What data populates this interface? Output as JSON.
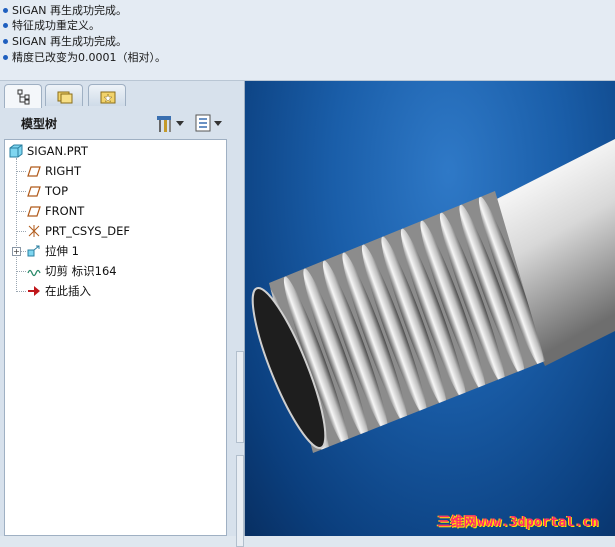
{
  "messages": [
    "SIGAN 再生成功完成。",
    "特征成功重定义。",
    "SIGAN 再生成功完成。",
    "精度已改变为0.0001（相对）。"
  ],
  "panel": {
    "tabs": [
      {
        "icon": "model-tree-tab-icon",
        "active": true
      },
      {
        "icon": "folder-browser-tab-icon",
        "active": false
      },
      {
        "icon": "favorites-tab-icon",
        "active": false
      }
    ],
    "tree_title": "模型树",
    "header_buttons": [
      "settings-tools-icon",
      "show-options-icon"
    ]
  },
  "tree": {
    "root": "SIGAN.PRT",
    "items": [
      {
        "label": "RIGHT",
        "icon": "datum-plane-icon"
      },
      {
        "label": "TOP",
        "icon": "datum-plane-icon"
      },
      {
        "label": "FRONT",
        "icon": "datum-plane-icon"
      },
      {
        "label": "PRT_CSYS_DEF",
        "icon": "coordinate-system-icon"
      },
      {
        "label": "拉伸 1",
        "icon": "extrude-icon",
        "expandable": true
      },
      {
        "label": "切剪 标识164",
        "icon": "cut-sweep-icon"
      },
      {
        "label": "在此插入",
        "icon": "insert-here-arrow-icon"
      }
    ]
  },
  "viewport": {
    "watermark": "三维网www.3dportal.cn",
    "background_colors": [
      "#2f79c7",
      "#0b3f7e"
    ]
  }
}
